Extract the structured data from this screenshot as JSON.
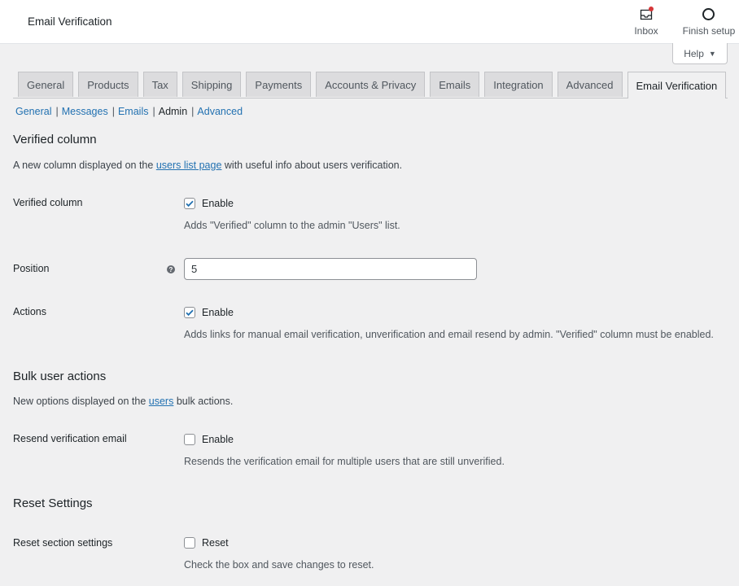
{
  "header": {
    "title": "Email Verification",
    "inbox_label": "Inbox",
    "finish_setup_label": "Finish setup",
    "help_label": "Help",
    "help_caret": "▼"
  },
  "tabs": [
    {
      "label": "General",
      "active": false
    },
    {
      "label": "Products",
      "active": false
    },
    {
      "label": "Tax",
      "active": false
    },
    {
      "label": "Shipping",
      "active": false
    },
    {
      "label": "Payments",
      "active": false
    },
    {
      "label": "Accounts & Privacy",
      "active": false
    },
    {
      "label": "Emails",
      "active": false
    },
    {
      "label": "Integration",
      "active": false
    },
    {
      "label": "Advanced",
      "active": false
    },
    {
      "label": "Email Verification",
      "active": true
    }
  ],
  "subnav": {
    "items": [
      "General",
      "Messages",
      "Emails",
      "Admin",
      "Advanced"
    ],
    "separator": "|",
    "current": "Admin"
  },
  "section1": {
    "title": "Verified column",
    "desc_before": "A new column displayed on the ",
    "desc_link": "users list page",
    "desc_after": " with useful info about users verification.",
    "verified_label": "Verified column",
    "verified_checkbox_label": "Enable",
    "verified_checked": true,
    "verified_help": "Adds \"Verified\" column to the admin \"Users\" list.",
    "position_label": "Position",
    "position_value": "5",
    "help_tip_glyph": "?",
    "actions_label": "Actions",
    "actions_checkbox_label": "Enable",
    "actions_checked": true,
    "actions_help": "Adds links for manual email verification, unverification and email resend by admin. \"Verified\" column must be enabled."
  },
  "section2": {
    "title": "Bulk user actions",
    "desc_before": "New options displayed on the ",
    "desc_link": "users",
    "desc_after": " bulk actions.",
    "resend_label": "Resend verification email",
    "resend_checkbox_label": "Enable",
    "resend_checked": false,
    "resend_help": "Resends the verification email for multiple users that are still unverified."
  },
  "section3": {
    "title": "Reset Settings",
    "reset_label": "Reset section settings",
    "reset_checkbox_label": "Reset",
    "reset_checked": false,
    "reset_help": "Check the box and save changes to reset."
  },
  "colors": {
    "link": "#2271b1",
    "checkmark": "#2271b1",
    "notification_dot": "#d63638"
  }
}
